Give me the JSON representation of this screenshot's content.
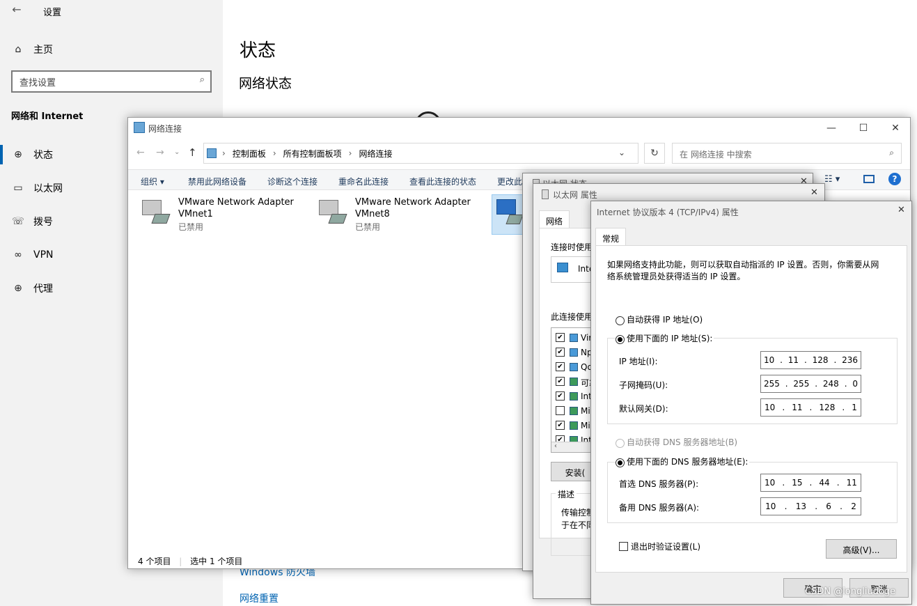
{
  "settings": {
    "title": "设置",
    "back_glyph": "←",
    "home": "主页",
    "search_placeholder": "查找设置",
    "section": "网络和 Internet",
    "nav": [
      {
        "label": "状态",
        "icon": "globe-icon"
      },
      {
        "label": "以太网",
        "icon": "ethernet-icon"
      },
      {
        "label": "拨号",
        "icon": "dialup-icon"
      },
      {
        "label": "VPN",
        "icon": "vpn-icon"
      },
      {
        "label": "代理",
        "icon": "globe-icon"
      }
    ],
    "heading": "状态",
    "subheading": "网络状态",
    "links": [
      "Windows 防火墙",
      "网络重置"
    ],
    "accent": "#0063b1"
  },
  "explorer": {
    "title": "网络连接",
    "breadcrumb": [
      "控制面板",
      "所有控制面板项",
      "网络连接"
    ],
    "search_placeholder": "在 网络连接 中搜索",
    "toolbar": [
      "组织 ▾",
      "禁用此网络设备",
      "诊断这个连接",
      "重命名此连接",
      "查看此连接的状态",
      "更改此"
    ],
    "adapters": [
      {
        "name1": "VMware Network Adapter",
        "name2": "VMnet1",
        "status": "已禁用"
      },
      {
        "name1": "VMware Network Adapter",
        "name2": "VMnet8",
        "status": "已禁用"
      }
    ],
    "status_count": "4 个项目",
    "status_selected": "选中 1 个项目"
  },
  "ethernet_status": {
    "title": "以太网 状态"
  },
  "ethernet_props": {
    "title": "以太网 属性",
    "tab": "网络",
    "connect_using": "连接时使用",
    "adapter_label": "Inte",
    "items_label": "此连接使用",
    "items": [
      {
        "label": "Vir",
        "checked": true
      },
      {
        "label": "Np",
        "checked": true
      },
      {
        "label": "Qo",
        "checked": true
      },
      {
        "label": "可靠",
        "checked": true
      },
      {
        "label": "Inte",
        "checked": true
      },
      {
        "label": "Mic",
        "checked": false
      },
      {
        "label": "Mic",
        "checked": true
      },
      {
        "label": "Inte",
        "checked": true
      }
    ],
    "install": "安装(",
    "desc_title": "描述",
    "desc_line1": "传输控制",
    "desc_line2": "于在不同"
  },
  "ipv4": {
    "title": "Internet 协议版本 4 (TCP/IPv4) 属性",
    "tab": "常规",
    "intro_line1": "如果网络支持此功能，则可以获取自动指派的 IP 设置。否则，你需要从网",
    "intro_line2": "络系统管理员处获得适当的 IP 设置。",
    "auto_ip": "自动获得 IP 地址(O)",
    "manual_ip": "使用下面的 IP 地址(S):",
    "ip_label": "IP 地址(I):",
    "ip": [
      "10",
      "11",
      "128",
      "236"
    ],
    "mask_label": "子网掩码(U):",
    "mask": [
      "255",
      "255",
      "248",
      "0"
    ],
    "gw_label": "默认网关(D):",
    "gw": [
      "10",
      "11",
      "128",
      "1"
    ],
    "auto_dns": "自动获得 DNS 服务器地址(B)",
    "manual_dns": "使用下面的 DNS 服务器地址(E):",
    "dns1_label": "首选 DNS 服务器(P):",
    "dns1": [
      "10",
      "15",
      "44",
      "11"
    ],
    "dns2_label": "备用 DNS 服务器(A):",
    "dns2": [
      "10",
      "13",
      "6",
      "2"
    ],
    "validate": "退出时验证设置(L)",
    "advanced": "高级(V)...",
    "ok": "确定",
    "cancel": "取消"
  },
  "watermark": "CSDN @longliudoge"
}
